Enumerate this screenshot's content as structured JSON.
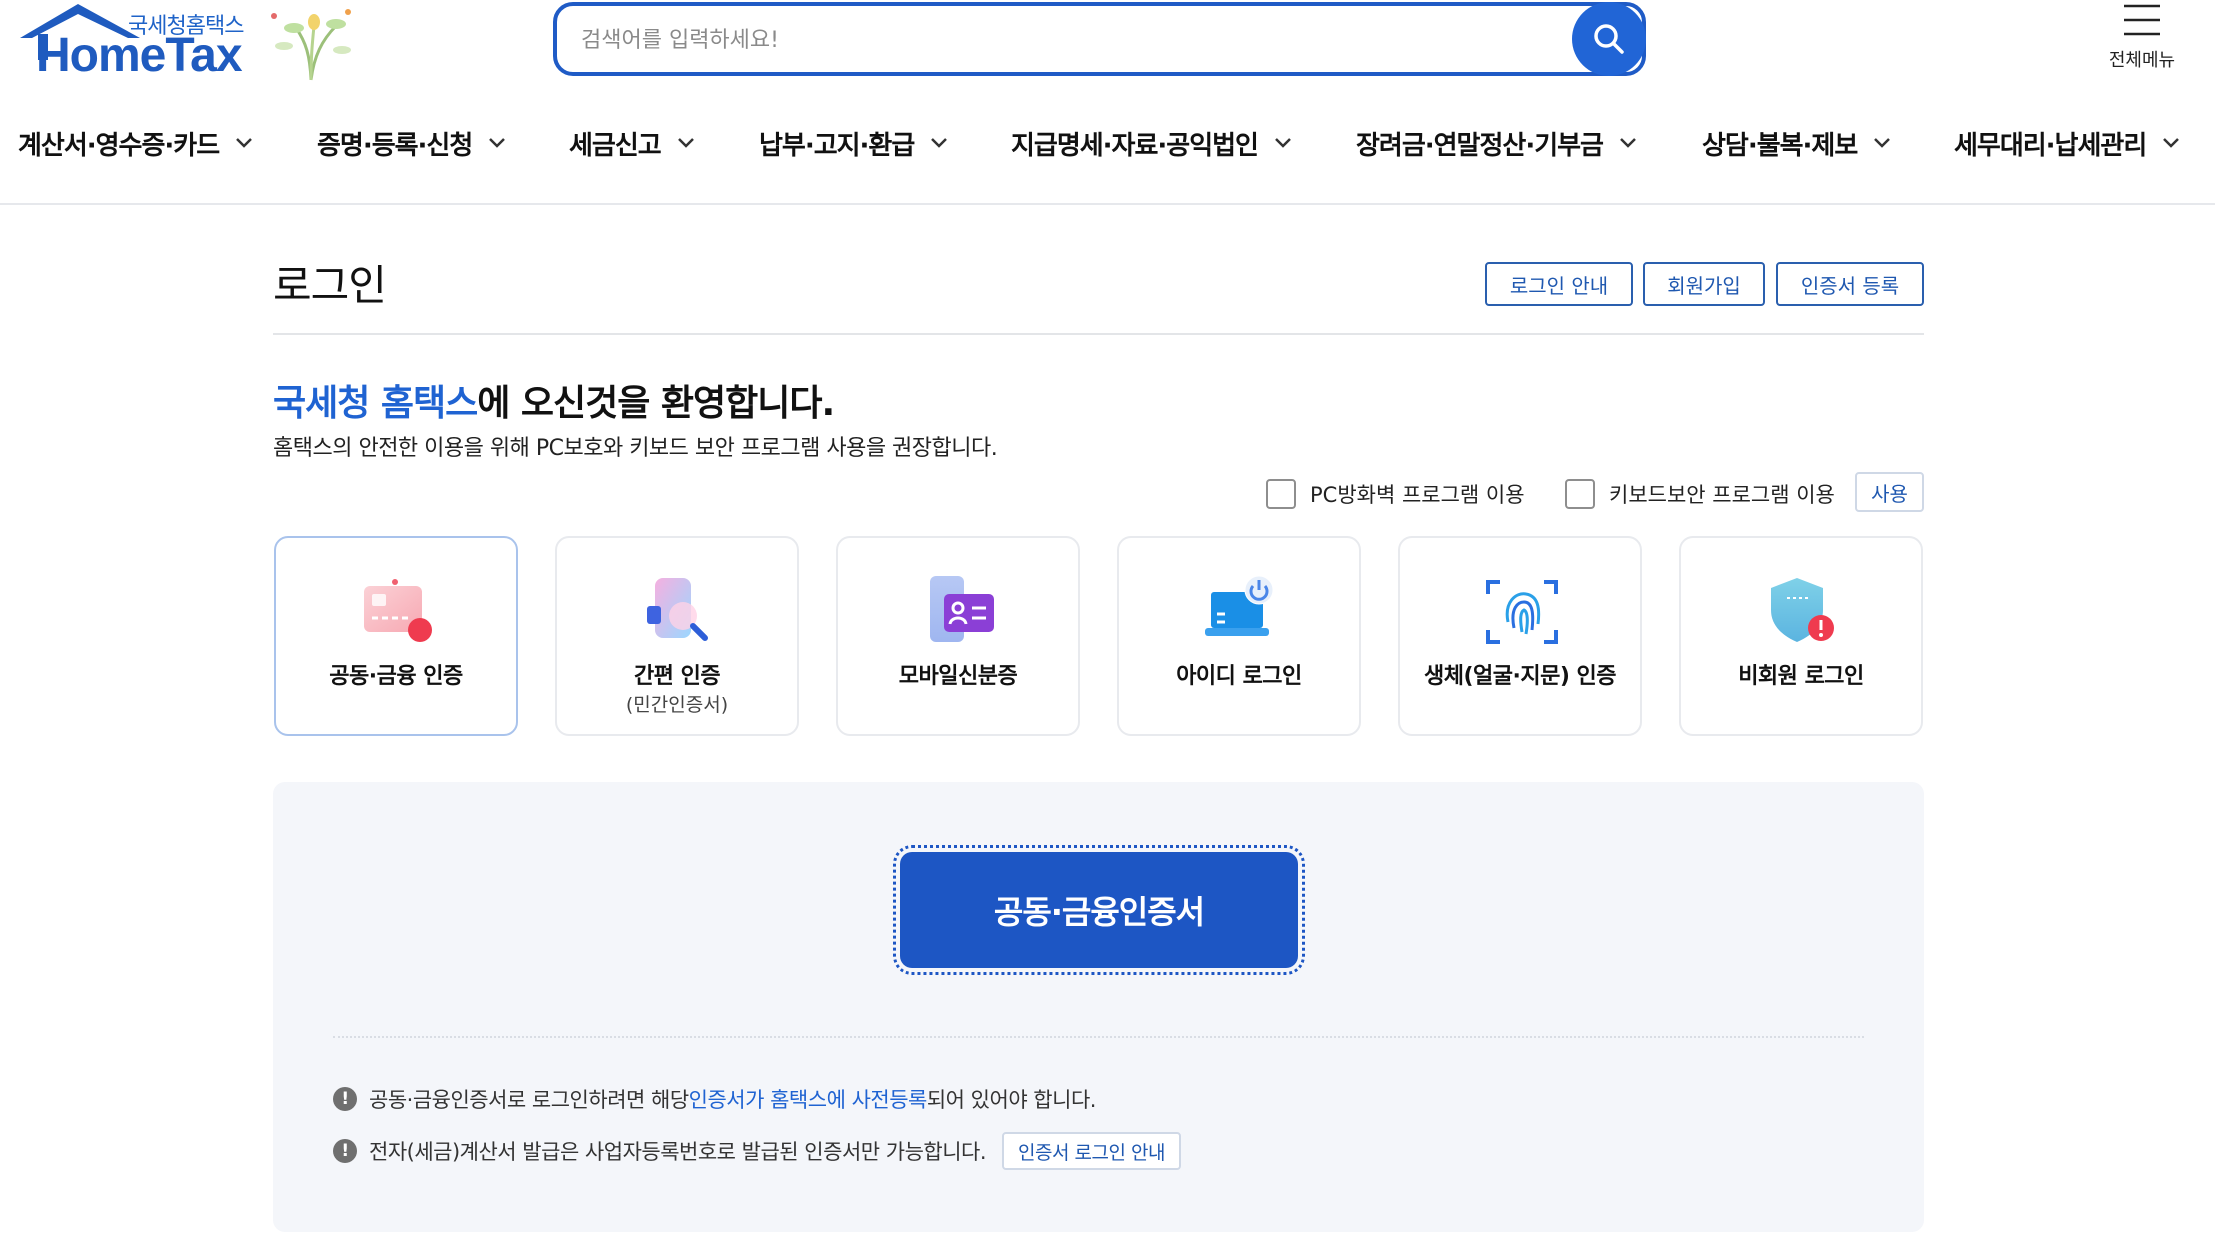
{
  "header": {
    "logo_sub": "국세청홈택스",
    "logo_main": "HomeTax",
    "search_placeholder": "검색어를 입력하세요!",
    "all_menu_label": "전체메뉴"
  },
  "nav": [
    "계산서·영수증·카드",
    "증명·등록·신청",
    "세금신고",
    "납부·고지·환급",
    "지급명세·자료·공익법인",
    "장려금·연말정산·기부금",
    "상담·불복·제보",
    "세무대리·납세관리"
  ],
  "page": {
    "title": "로그인",
    "buttons": {
      "login_guide": "로그인 안내",
      "join": "회원가입",
      "cert_register": "인증서 등록"
    },
    "welcome_highlight": "국세청 홈택스",
    "welcome_rest": "에 오신것을 환영합니다.",
    "description": "홈택스의 안전한 이용을 위해 PC보호와 키보드 보안 프로그램 사용을 권장합니다.",
    "options": {
      "firewall": "PC방화벽 프로그램 이용",
      "keyboard": "키보드보안 프로그램 이용",
      "use_btn": "사용"
    }
  },
  "login_methods": [
    {
      "label": "공동·금융 인증",
      "sub": ""
    },
    {
      "label": "간편 인증",
      "sub": "(민간인증서)"
    },
    {
      "label": "모바일신분증",
      "sub": ""
    },
    {
      "label": "아이디 로그인",
      "sub": ""
    },
    {
      "label": "생체(얼굴·지문) 인증",
      "sub": ""
    },
    {
      "label": "비회원 로그인",
      "sub": ""
    }
  ],
  "panel": {
    "cert_button": "공동·금융인증서",
    "notice1_pre": "공동·금융인증서로 로그인하려면 해당 ",
    "notice1_link": "인증서가 홈택스에 사전등록",
    "notice1_post": "되어 있어야 합니다.",
    "notice2": "전자(세금)계산서 발급은 사업자등록번호로 발급된 인증서만 가능합니다.",
    "notice2_btn": "인증서 로그인 안내"
  },
  "colors": {
    "brand": "#1f5bbf",
    "primary_button": "#1d56c4",
    "link": "#1f63d2",
    "panel_bg": "#f4f6fa"
  },
  "icons": [
    "search-icon",
    "hamburger-menu-icon",
    "chevron-down-icon",
    "exclamation-icon"
  ]
}
